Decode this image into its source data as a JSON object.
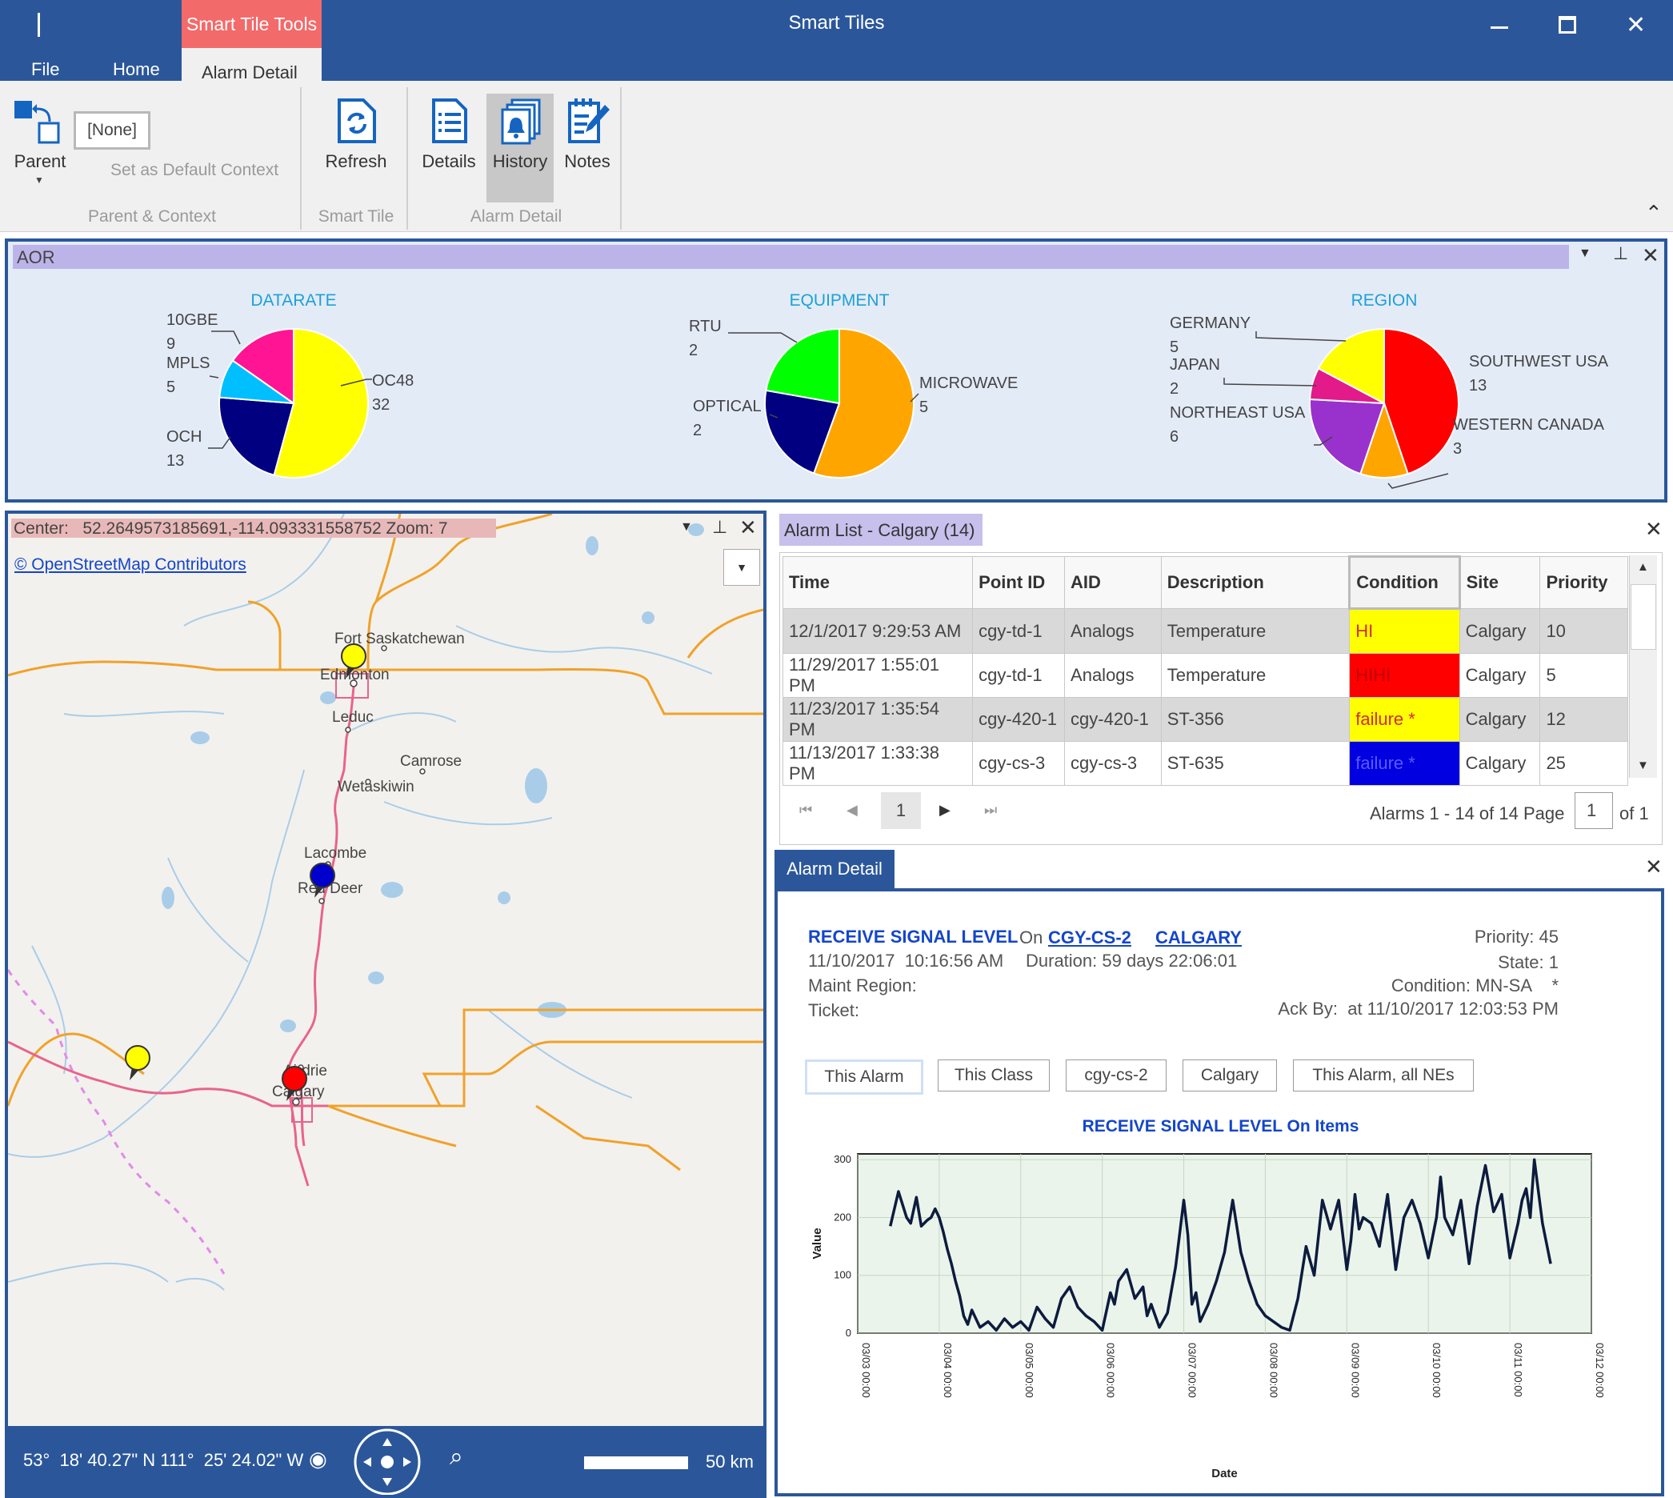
{
  "app": {
    "title": "Smart Tiles",
    "context_tab": "Smart Tile Tools",
    "tabs": [
      "File",
      "Home",
      "Alarm Detail"
    ],
    "window_controls": [
      "minimize-icon",
      "maximize-icon",
      "close-icon"
    ]
  },
  "ribbon": {
    "parent_label": "Parent",
    "context_value": "[None]",
    "set_default_label": "Set as Default Context",
    "group_parent": "Parent & Context",
    "refresh_label": "Refresh",
    "group_smart_tile": "Smart Tile",
    "details_label": "Details",
    "history_label": "History",
    "notes_label": "Notes",
    "group_alarm_detail": "Alarm Detail"
  },
  "aor": {
    "title": "AOR",
    "charts": [
      {
        "title": "DATARATE",
        "slices": [
          {
            "label": "OC48",
            "value": "32",
            "color": "#ffff00"
          },
          {
            "label": "OCH",
            "value": "13",
            "color": "#000080"
          },
          {
            "label": "MPLS",
            "value": "5",
            "color": "#00bfff"
          },
          {
            "label": "10GBE",
            "value": "9",
            "color": "#ff1493"
          }
        ]
      },
      {
        "title": "EQUIPMENT",
        "slices": [
          {
            "label": "MICROWAVE",
            "value": "5",
            "color": "#ffa500"
          },
          {
            "label": "OPTICAL",
            "value": "2",
            "color": "#000080"
          },
          {
            "label": "RTU",
            "value": "2",
            "color": "#00ff00"
          }
        ]
      },
      {
        "title": "REGION",
        "slices": [
          {
            "label": "SOUTHWEST USA",
            "value": "13",
            "color": "#ff0000"
          },
          {
            "label": "WESTERN CANADA",
            "value": "3",
            "color": "#ffa500"
          },
          {
            "label": "NORTHEAST USA",
            "value": "6",
            "color": "#9932cc"
          },
          {
            "label": "JAPAN",
            "value": "2",
            "color": "#e31a8a"
          },
          {
            "label": "GERMANY",
            "value": "5",
            "color": "#ffff00"
          }
        ]
      }
    ]
  },
  "map": {
    "header": "Center:   52.2649573185691,-114.093331558752 Zoom: 7",
    "attribution": "© OpenStreetMap Contributors",
    "places": [
      "Fort Saskatchewan",
      "Edmonton",
      "Leduc",
      "Camrose",
      "Wetaskiwin",
      "Lacombe",
      "Red Deer",
      "Airdrie",
      "Calgary"
    ],
    "coords": "53°  18' 40.27\" N 111°  25' 24.02\" W",
    "scale": "50 km",
    "marker_colors": [
      "#ffff00",
      "#0000cc",
      "#ff0000",
      "#ffff00"
    ]
  },
  "alarm_list": {
    "title": "Alarm List - Calgary (14)",
    "columns": [
      "Time",
      "Point ID",
      "AID",
      "Description",
      "Condition",
      "Site",
      "Priority"
    ],
    "rows": [
      {
        "time": "12/1/2017 9:29:53 AM",
        "point": "cgy-td-1",
        "aid": "Analogs",
        "desc": "Temperature",
        "cond": "HI",
        "cond_color": "#ffff00",
        "cond_text_color": "#d12c2c",
        "site": "Calgary",
        "priority": "10"
      },
      {
        "time": "11/29/2017 1:55:01 PM",
        "point": "cgy-td-1",
        "aid": "Analogs",
        "desc": "Temperature",
        "cond": "HIHI",
        "cond_color": "#ff0000",
        "cond_text_color": "#c00000",
        "site": "Calgary",
        "priority": "5"
      },
      {
        "time": "11/23/2017 1:35:54 PM",
        "point": "cgy-420-1",
        "aid": "cgy-420-1",
        "desc": "ST-356",
        "cond": "failure *",
        "cond_color": "#ffff00",
        "cond_text_color": "#d12c2c",
        "site": "Calgary",
        "priority": "12"
      },
      {
        "time": "11/13/2017 1:33:38 PM",
        "point": "cgy-cs-3",
        "aid": "cgy-cs-3",
        "desc": "ST-635",
        "cond": "failure *",
        "cond_color": "#0000e0",
        "cond_text_color": "#5a5aff",
        "site": "Calgary",
        "priority": "25"
      }
    ],
    "page": "1",
    "summary": "Alarms 1 - 14 of 14 Page",
    "page_input": "1",
    "of": "of 1"
  },
  "alarm_detail": {
    "tab": "Alarm Detail",
    "point": "RECEIVE SIGNAL LEVEL",
    "on_label": "On",
    "ne": "CGY-CS-2",
    "site": "CALGARY",
    "time": "11/10/2017  10:16:56 AM",
    "duration": "Duration: 59 days 22:06:01",
    "maint_region": "Maint Region:",
    "ticket": "Ticket:",
    "priority": "Priority: 45",
    "state": "State: 1",
    "condition": "Condition: MN-SA",
    "condition_flag": "*",
    "ack": "Ack By:  at 11/10/2017 12:03:53 PM",
    "buttons": [
      "This Alarm",
      "This Class",
      "cgy-cs-2",
      "Calgary",
      "This Alarm, all NEs"
    ]
  },
  "chart_data": {
    "type": "line",
    "title": "RECEIVE SIGNAL LEVEL On Items",
    "xlabel": "Date",
    "ylabel": "Value",
    "yticks": [
      "0",
      "100",
      "200",
      "300"
    ],
    "ylim": [
      0,
      310
    ],
    "xticks": [
      "03/03 00:00",
      "03/04 00:00",
      "03/05 00:00",
      "03/06 00:00",
      "03/07 00:00",
      "03/08 00:00",
      "03/09 00:00",
      "03/10 00:00",
      "03/11 00:00",
      "03/12 00:00"
    ],
    "xlim": [
      0,
      9.0
    ],
    "grid": true,
    "series": [
      {
        "color": "#0d1b3e",
        "x": [
          0.4,
          0.5,
          0.6,
          0.65,
          0.72,
          0.78,
          0.85,
          0.9,
          0.95,
          1.0,
          1.05,
          1.1,
          1.15,
          1.2,
          1.25,
          1.3,
          1.35,
          1.4,
          1.45,
          1.5,
          1.6,
          1.7,
          1.8,
          1.9,
          2.0,
          2.1,
          2.2,
          2.3,
          2.4,
          2.5,
          2.6,
          2.7,
          2.8,
          2.9,
          3.0,
          3.1,
          3.15,
          3.2,
          3.3,
          3.4,
          3.5,
          3.55,
          3.6,
          3.7,
          3.8,
          3.9,
          4.0,
          4.05,
          4.1,
          4.15,
          4.2,
          4.3,
          4.4,
          4.5,
          4.6,
          4.7,
          4.8,
          4.9,
          5.0,
          5.1,
          5.2,
          5.3,
          5.4,
          5.5,
          5.6,
          5.7,
          5.8,
          5.9,
          6.0,
          6.05,
          6.1,
          6.15,
          6.2,
          6.3,
          6.4,
          6.5,
          6.6,
          6.7,
          6.8,
          6.9,
          7.0,
          7.1,
          7.15,
          7.2,
          7.3,
          7.4,
          7.5,
          7.6,
          7.7,
          7.8,
          7.9,
          8.0,
          8.1,
          8.15,
          8.2,
          8.25,
          8.3,
          8.4,
          8.5
        ],
        "y": [
          185,
          245,
          200,
          190,
          235,
          185,
          195,
          200,
          215,
          200,
          175,
          145,
          120,
          90,
          65,
          30,
          15,
          40,
          25,
          10,
          20,
          5,
          25,
          10,
          20,
          5,
          45,
          25,
          10,
          60,
          80,
          45,
          30,
          20,
          5,
          70,
          50,
          90,
          110,
          60,
          80,
          30,
          50,
          10,
          35,
          115,
          230,
          170,
          50,
          70,
          20,
          50,
          90,
          140,
          230,
          140,
          90,
          50,
          30,
          20,
          10,
          5,
          60,
          150,
          100,
          230,
          180,
          230,
          110,
          160,
          240,
          180,
          200,
          190,
          150,
          240,
          110,
          200,
          230,
          190,
          130,
          200,
          270,
          200,
          170,
          230,
          120,
          220,
          290,
          210,
          240,
          130,
          190,
          230,
          250,
          200,
          300,
          190,
          120
        ]
      }
    ]
  }
}
